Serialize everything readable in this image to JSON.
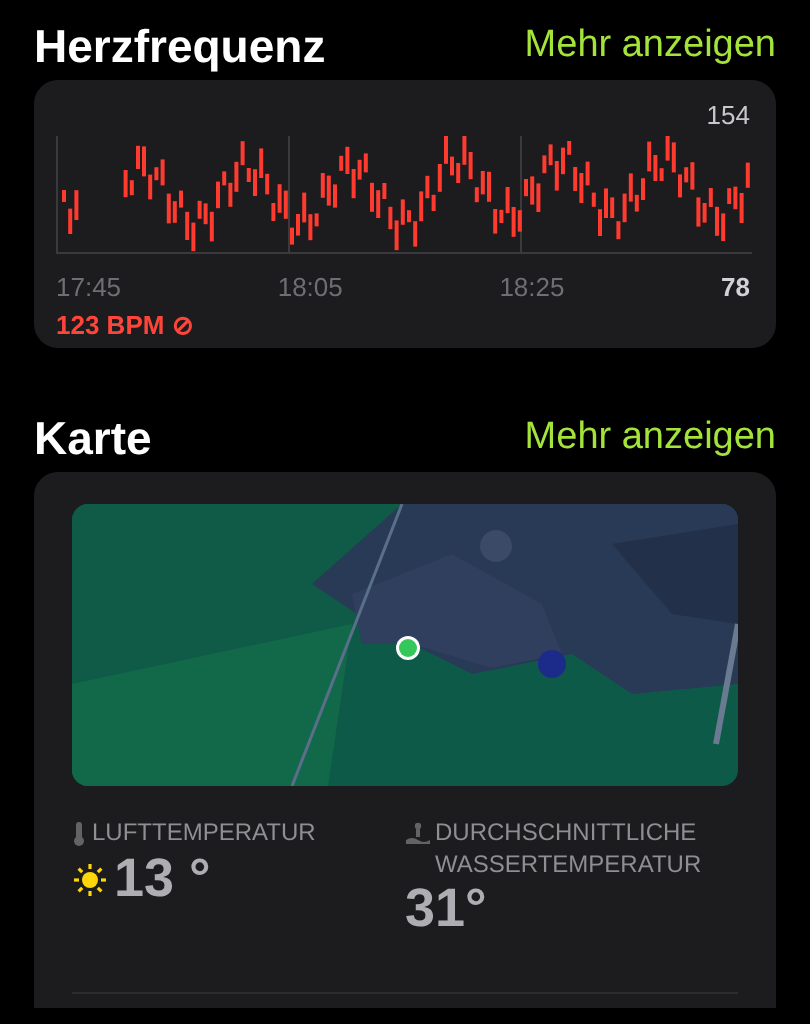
{
  "sections": [
    {
      "kind": "chart",
      "title": "Herzfrequenz",
      "link": "Mehr anzeigen",
      "max_label": "154",
      "min_label": "78",
      "times": [
        "17:45",
        "18:05",
        "18:25"
      ],
      "reading": "123 BPM",
      "reading_icon": "⊘"
    },
    {
      "kind": "map",
      "title": "Karte",
      "link": "Mehr anzeigen",
      "map": {
        "kind": "picture"
      },
      "stats": [
        {
          "kind": "air",
          "label": "LUFTTEMPERATUR",
          "value": "13 °"
        },
        {
          "kind": "water",
          "label": "DURCHSCHNITTLICHE WASSERTEMPERATUR",
          "value": "31°"
        }
      ]
    }
  ]
}
